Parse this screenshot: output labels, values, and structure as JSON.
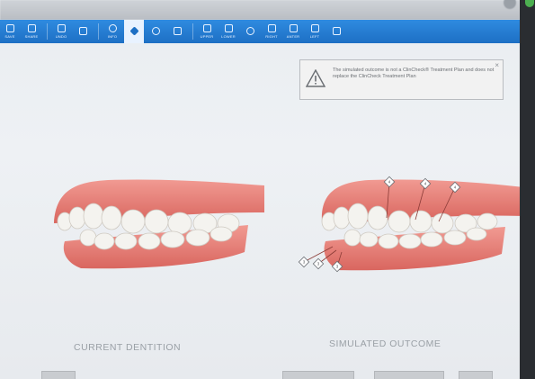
{
  "window": {
    "title": ""
  },
  "toolbar": {
    "buttons": [
      {
        "label": "SAVE"
      },
      {
        "label": "SHARE"
      },
      {
        "label": "UNDO"
      },
      {
        "label": ""
      },
      {
        "label": "INFO"
      },
      {
        "label": ""
      },
      {
        "label": ""
      },
      {
        "label": ""
      },
      {
        "label": "UPPER"
      },
      {
        "label": "LOWER"
      },
      {
        "label": ""
      },
      {
        "label": "RIGHT"
      },
      {
        "label": "ANTER"
      },
      {
        "label": "LEFT"
      },
      {
        "label": ""
      }
    ],
    "patient": ""
  },
  "notice": {
    "message": "The simulated outcome is not a ClinCheck® Treatment Plan and does not replace the ClinCheck Treatment Plan",
    "close": "×"
  },
  "views": {
    "current_label": "CURRENT DENTITION",
    "simulated_label": "SIMULATED OUTCOME"
  },
  "markers": [
    "4",
    "4",
    "4",
    "3",
    "3",
    "3"
  ],
  "bottom_buttons": [
    {
      "label": ""
    },
    {
      "label": ""
    },
    {
      "label": ""
    },
    {
      "label": ""
    }
  ]
}
